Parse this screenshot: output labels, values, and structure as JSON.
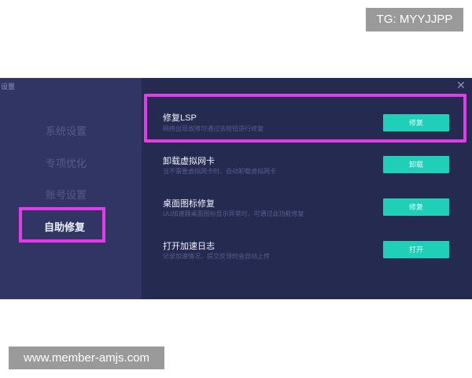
{
  "watermarks": {
    "top": "TG: MYYJJPP",
    "bottom": "www.member-amjs.com"
  },
  "window": {
    "title": "设置",
    "close_symbol": "✕"
  },
  "sidebar": {
    "items": [
      {
        "label": "系统设置"
      },
      {
        "label": "专项优化"
      },
      {
        "label": "账号设置"
      },
      {
        "label": "自助修复",
        "active": true
      }
    ]
  },
  "main": {
    "rows": [
      {
        "title": "修复LSP",
        "description": "网络出现故障可通过该按钮进行修复",
        "button": "修复",
        "highlighted": true
      },
      {
        "title": "卸载虚拟网卡",
        "description": "当不需要虚拟网卡时，自动卸载虚拟网卡",
        "button": "卸载"
      },
      {
        "title": "桌面图标修复",
        "description": "UU加速器桌面图标显示异常时，可通过此功能修复",
        "button": "修复"
      },
      {
        "title": "打开加速日志",
        "description": "记录加速情况，提交反馈时会自动上传",
        "button": "打开"
      }
    ]
  },
  "colors": {
    "sidebar_bg": "#303563",
    "main_bg": "#252a50",
    "accent_button": "#1fcfb8",
    "highlight_border": "#e23ce8"
  }
}
